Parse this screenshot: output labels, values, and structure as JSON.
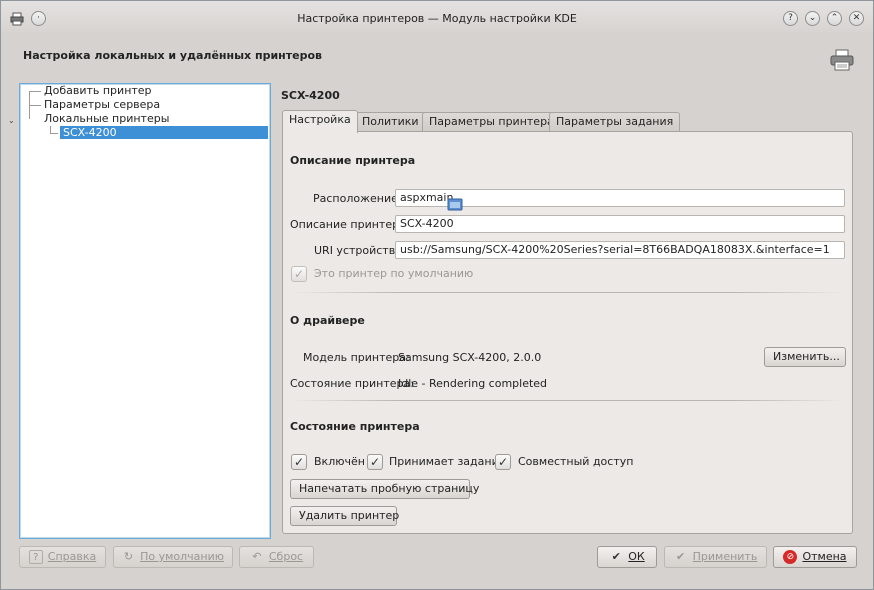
{
  "window": {
    "title": "Настройка принтеров — Модуль настройки KDE",
    "buttons": [
      "?",
      "⌄",
      "⌃",
      "✕"
    ]
  },
  "header": {
    "title": "Настройка локальных и удалённых принтеров"
  },
  "tree": {
    "items": [
      {
        "label": "Добавить принтер"
      },
      {
        "label": "Параметры сервера"
      },
      {
        "label": "Локальные принтеры"
      }
    ],
    "selected": "SCX-4200"
  },
  "device": {
    "name": "SCX-4200"
  },
  "tabs": [
    "Настройка",
    "Политики",
    "Параметры принтера",
    "Параметры задания"
  ],
  "description": {
    "section": "Описание принтера",
    "location_label": "Расположение:",
    "location_value": "aspxmain",
    "desc_label": "Описание принтера:",
    "desc_value": "SCX-4200",
    "uri_label": "URI устройства:",
    "uri_value": "usb://Samsung/SCX-4200%20Series?serial=8T66BADQA18083X.&interface=1",
    "default_label": "Это принтер по умолчанию",
    "default_checked": true
  },
  "driver": {
    "section": "О драйвере",
    "model_label": "Модель принтера:",
    "model_value": "Samsung SCX-4200, 2.0.0",
    "change_button": "Изменить...",
    "status_label": "Состояние принтера:",
    "status_value": "Idle - Rendering completed"
  },
  "state": {
    "section": "Состояние принтера",
    "enabled_label": "Включён",
    "accepts_label": "Принимает задания",
    "shared_label": "Совместный доступ",
    "test_page_button": "Напечатать пробную страницу",
    "remove_button": "Удалить принтер"
  },
  "footer": {
    "help": "Справка",
    "defaults": "По умолчанию",
    "reset": "Сброс",
    "ok": "ОК",
    "apply": "Применить",
    "cancel": "Отмена"
  },
  "colors": {
    "selection": "#3d8fd6",
    "cancel_icon": "#d42a2a"
  }
}
